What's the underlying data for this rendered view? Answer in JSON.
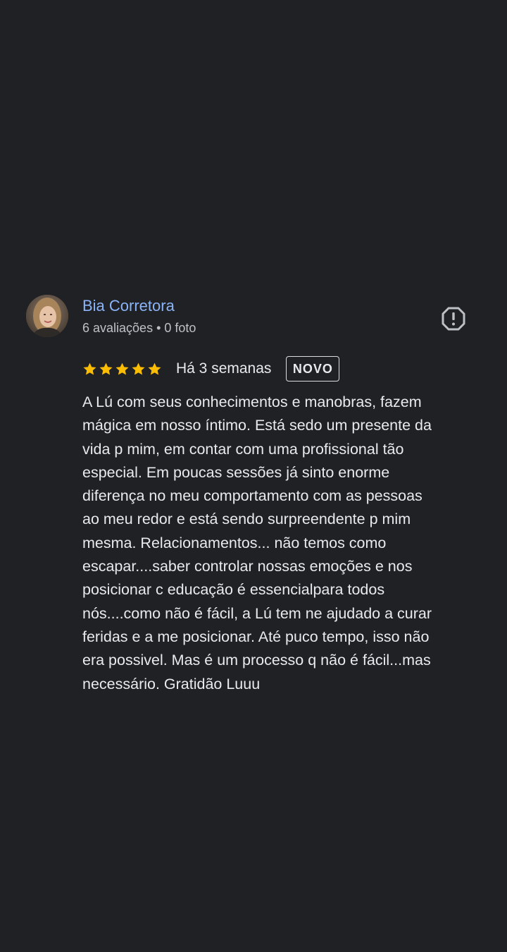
{
  "review": {
    "reviewer": {
      "name": "Bia Corretora",
      "meta": "6 avaliações • 0 foto"
    },
    "rating": {
      "stars": 5,
      "max": 5,
      "star_color": "#fbbc04"
    },
    "date": "Há 3 semanas",
    "badge": "NOVO",
    "text_lines": [
      "A Lú com seus conhecimentos e manobras, fazem",
      "mágica em nosso íntimo. Está sedo um presente da",
      "vida p mim, em contar com uma profissional tão",
      "especial. Em poucas sessões já sinto enorme",
      "diferença no meu comportamento com as pessoas",
      "ao meu redor e está sendo surpreendente p mim",
      "mesma. Relacionamentos... não temos como",
      "escapar....saber controlar nossas emoções e nos",
      "posicionar c educação é essencialpara todos",
      "nós....como não é fácil, a Lú tem ne ajudado a curar",
      "feridas e a me posicionar. Até puco tempo, isso não",
      "era possivel. Mas é um processo q não é fácil...mas",
      "necessário. Gratidão Luuu"
    ],
    "icons": {
      "avatar": "reviewer-photo",
      "report": "report-icon",
      "star": "star-icon"
    }
  },
  "colors": {
    "background": "#202124",
    "name": "#8ab4f8",
    "text": "#e8eaed",
    "meta": "#bdc1c6"
  }
}
